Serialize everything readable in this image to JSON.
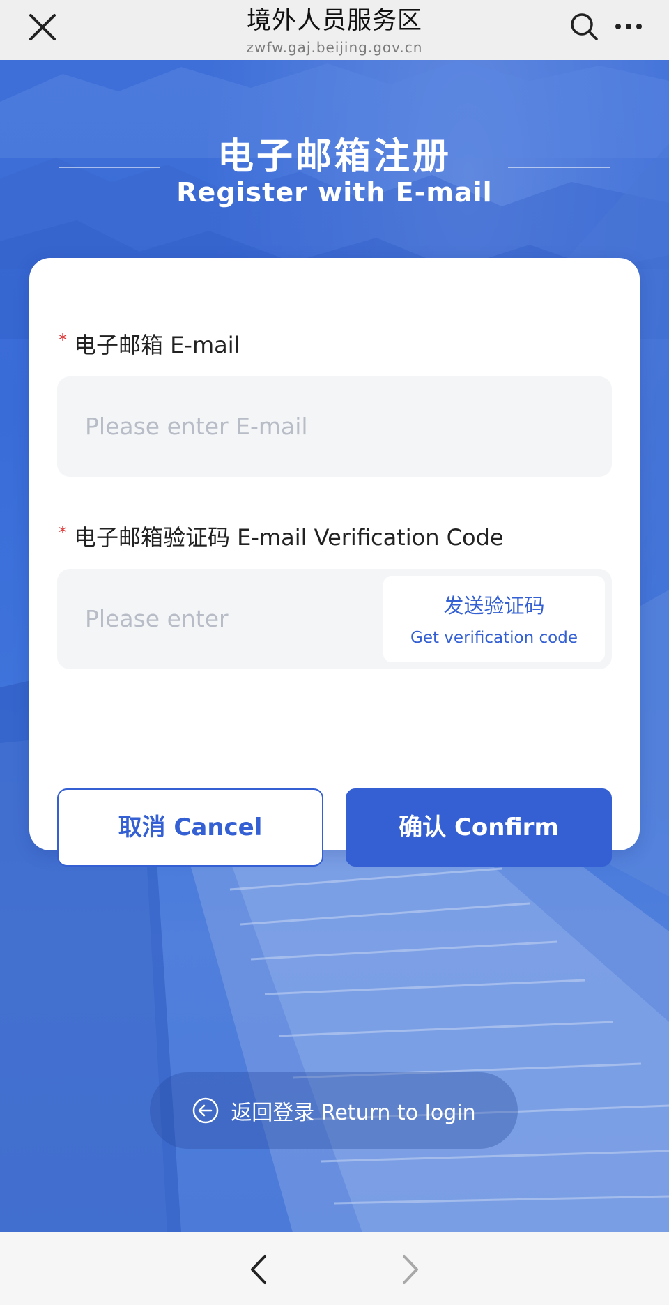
{
  "browser": {
    "title": "境外人员服务区",
    "url": "zwfw.gaj.beijing.gov.cn",
    "icons": [
      "close-icon",
      "search-icon",
      "more-icon"
    ]
  },
  "header": {
    "title_zh": "电子邮箱注册",
    "title_en": "Register with E-mail"
  },
  "form": {
    "email": {
      "required_mark": "*",
      "label": "电子邮箱 E-mail",
      "placeholder": "Please enter E-mail"
    },
    "code": {
      "required_mark": "*",
      "label": "电子邮箱验证码 E-mail Verification Code",
      "placeholder": "Please enter",
      "send_zh": "发送验证码",
      "send_en": "Get verification code"
    },
    "cancel_label": "取消 Cancel",
    "confirm_label": "确认 Confirm"
  },
  "return_link": {
    "label": "返回登录 Return to login",
    "icon": "arrow-left-circle-icon"
  },
  "bottom_nav": {
    "icons": [
      "back-icon",
      "forward-icon"
    ]
  },
  "colors": {
    "accent": "#3460d3",
    "required": "#e03a3a",
    "hero_blue": "#3f74db"
  }
}
